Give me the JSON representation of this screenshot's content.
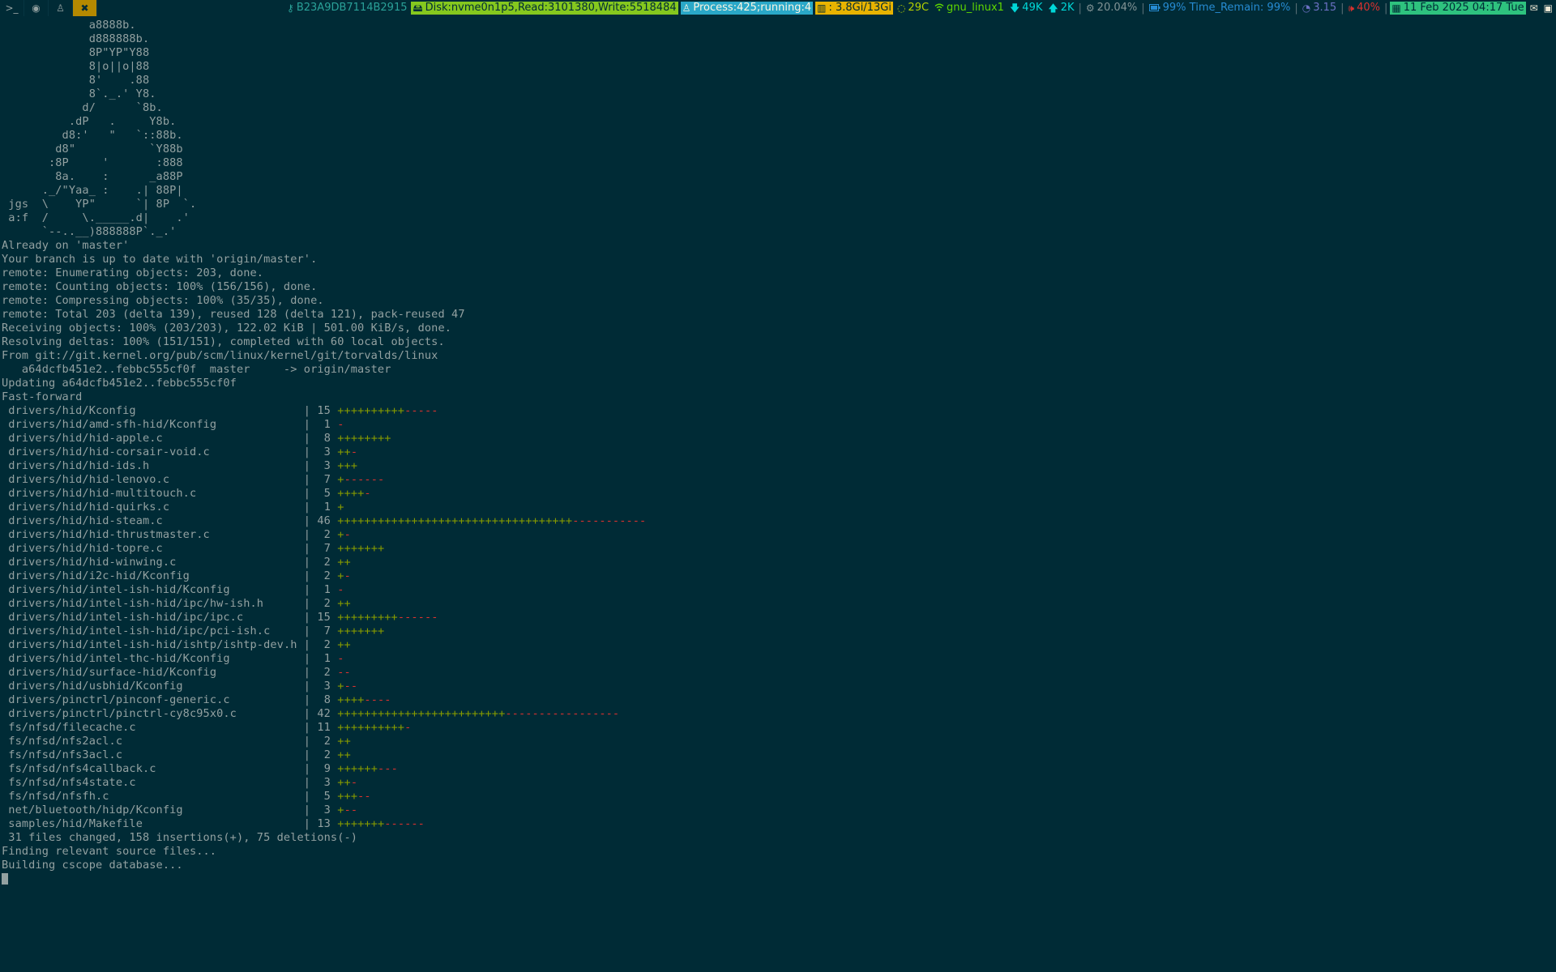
{
  "topbar": {
    "workspaces": [
      {
        "icon": "terminal-icon",
        "glyph": ">_",
        "active": false
      },
      {
        "icon": "browser-icon",
        "glyph": "◉",
        "active": false
      },
      {
        "icon": "linux-penguin-icon",
        "glyph": "♙",
        "active": false
      },
      {
        "icon": "tools-icon",
        "glyph": "✖",
        "active": true
      }
    ],
    "serial": "B23A9DB7114B2915",
    "disk": "Disk:nvme0n1p5,Read:3101380,Write:5518484",
    "process": "Process:425;running:4",
    "memory": ": 3.8Gi/13Gi",
    "temperature": "29C",
    "wifi": "gnu_linux1",
    "net_down": "49K",
    "net_up": "2K",
    "cpu": "20.04%",
    "battery": "99% Time_Remain: 99%",
    "load": "3.15",
    "volume": "40%",
    "datetime": "11 Feb 2025 04:17 Tue",
    "colors": {
      "bar_bg": "#002b36",
      "serial_fg": "#2aa198",
      "disk_bg": "#85c81e",
      "process_bg": "#2aa8c8",
      "memory_bg": "#e8b300",
      "temp_fg": "#b5d000",
      "wifi_fg": "#5fd700",
      "net_fg": "#00d7d7",
      "cpu_fg": "#839496",
      "battery_fg": "#268bd2",
      "load_fg": "#6c71c4",
      "volume_fg": "#dc322f",
      "date_bg": "#2ec27e"
    }
  },
  "terminal": {
    "ascii_art": [
      "             a8888b.",
      "             d888888b.",
      "             8P\"YP\"Y88",
      "             8|o||o|88",
      "             8'    .88",
      "             8`._.' Y8.",
      "            d/      `8b.",
      "          .dP   .     Y8b.",
      "         d8:'   \"   `::88b.",
      "        d8\"           `Y88b",
      "       :8P     '       :888",
      "        8a.    :      _a88P",
      "      ._/\"Yaa_ :    .| 88P|",
      " jgs  \\    YP\"      `| 8P  `.",
      " a:f  /     \\._____.d|    .'",
      "      `--..__)888888P`._.'"
    ],
    "git_output": [
      "Already on 'master'",
      "Your branch is up to date with 'origin/master'.",
      "remote: Enumerating objects: 203, done.",
      "remote: Counting objects: 100% (156/156), done.",
      "remote: Compressing objects: 100% (35/35), done.",
      "remote: Total 203 (delta 139), reused 128 (delta 121), pack-reused 47",
      "Receiving objects: 100% (203/203), 122.02 KiB | 501.00 KiB/s, done.",
      "Resolving deltas: 100% (151/151), completed with 60 local objects.",
      "From git://git.kernel.org/pub/scm/linux/kernel/git/torvalds/linux",
      "   a64dcfb451e2..febbc555cf0f  master     -> origin/master",
      "Updating a64dcfb451e2..febbc555cf0f",
      "Fast-forward"
    ],
    "diffstat": [
      {
        "path": "drivers/hid/Kconfig",
        "count": "15",
        "plus": "++++++++++",
        "minus": "-----"
      },
      {
        "path": "drivers/hid/amd-sfh-hid/Kconfig",
        "count": "1",
        "plus": "",
        "minus": "-"
      },
      {
        "path": "drivers/hid/hid-apple.c",
        "count": "8",
        "plus": "++++++++",
        "minus": ""
      },
      {
        "path": "drivers/hid/hid-corsair-void.c",
        "count": "3",
        "plus": "++",
        "minus": "-"
      },
      {
        "path": "drivers/hid/hid-ids.h",
        "count": "3",
        "plus": "+++",
        "minus": ""
      },
      {
        "path": "drivers/hid/hid-lenovo.c",
        "count": "7",
        "plus": "+",
        "minus": "------"
      },
      {
        "path": "drivers/hid/hid-multitouch.c",
        "count": "5",
        "plus": "++++",
        "minus": "-"
      },
      {
        "path": "drivers/hid/hid-quirks.c",
        "count": "1",
        "plus": "+",
        "minus": ""
      },
      {
        "path": "drivers/hid/hid-steam.c",
        "count": "46",
        "plus": "+++++++++++++++++++++++++++++++++++",
        "minus": "-----------"
      },
      {
        "path": "drivers/hid/hid-thrustmaster.c",
        "count": "2",
        "plus": "+",
        "minus": "-"
      },
      {
        "path": "drivers/hid/hid-topre.c",
        "count": "7",
        "plus": "+++++++",
        "minus": ""
      },
      {
        "path": "drivers/hid/hid-winwing.c",
        "count": "2",
        "plus": "++",
        "minus": ""
      },
      {
        "path": "drivers/hid/i2c-hid/Kconfig",
        "count": "2",
        "plus": "+",
        "minus": "-"
      },
      {
        "path": "drivers/hid/intel-ish-hid/Kconfig",
        "count": "1",
        "plus": "",
        "minus": "-"
      },
      {
        "path": "drivers/hid/intel-ish-hid/ipc/hw-ish.h",
        "count": "2",
        "plus": "++",
        "minus": ""
      },
      {
        "path": "drivers/hid/intel-ish-hid/ipc/ipc.c",
        "count": "15",
        "plus": "+++++++++",
        "minus": "------"
      },
      {
        "path": "drivers/hid/intel-ish-hid/ipc/pci-ish.c",
        "count": "7",
        "plus": "+++++++",
        "minus": ""
      },
      {
        "path": "drivers/hid/intel-ish-hid/ishtp/ishtp-dev.h",
        "count": "2",
        "plus": "++",
        "minus": ""
      },
      {
        "path": "drivers/hid/intel-thc-hid/Kconfig",
        "count": "1",
        "plus": "",
        "minus": "-"
      },
      {
        "path": "drivers/hid/surface-hid/Kconfig",
        "count": "2",
        "plus": "",
        "minus": "--"
      },
      {
        "path": "drivers/hid/usbhid/Kconfig",
        "count": "3",
        "plus": "+",
        "minus": "--"
      },
      {
        "path": "drivers/pinctrl/pinconf-generic.c",
        "count": "8",
        "plus": "++++",
        "minus": "----"
      },
      {
        "path": "drivers/pinctrl/pinctrl-cy8c95x0.c",
        "count": "42",
        "plus": "+++++++++++++++++++++++++",
        "minus": "-----------------"
      },
      {
        "path": "fs/nfsd/filecache.c",
        "count": "11",
        "plus": "++++++++++",
        "minus": "-"
      },
      {
        "path": "fs/nfsd/nfs2acl.c",
        "count": "2",
        "plus": "++",
        "minus": ""
      },
      {
        "path": "fs/nfsd/nfs3acl.c",
        "count": "2",
        "plus": "++",
        "minus": ""
      },
      {
        "path": "fs/nfsd/nfs4callback.c",
        "count": "9",
        "plus": "++++++",
        "minus": "---"
      },
      {
        "path": "fs/nfsd/nfs4state.c",
        "count": "3",
        "plus": "++",
        "minus": "-"
      },
      {
        "path": "fs/nfsd/nfsfh.c",
        "count": "5",
        "plus": "+++",
        "minus": "--"
      },
      {
        "path": "net/bluetooth/hidp/Kconfig",
        "count": "3",
        "plus": "+",
        "minus": "--"
      },
      {
        "path": "samples/hid/Makefile",
        "count": "13",
        "plus": "+++++++",
        "minus": "------"
      }
    ],
    "summary": " 31 files changed, 158 insertions(+), 75 deletions(-)",
    "tail": [
      "Finding relevant source files...",
      "Building cscope database..."
    ],
    "colors": {
      "bg": "#002b36",
      "fg": "#93a1a1",
      "plus": "#859900",
      "minus": "#dc322f"
    }
  }
}
